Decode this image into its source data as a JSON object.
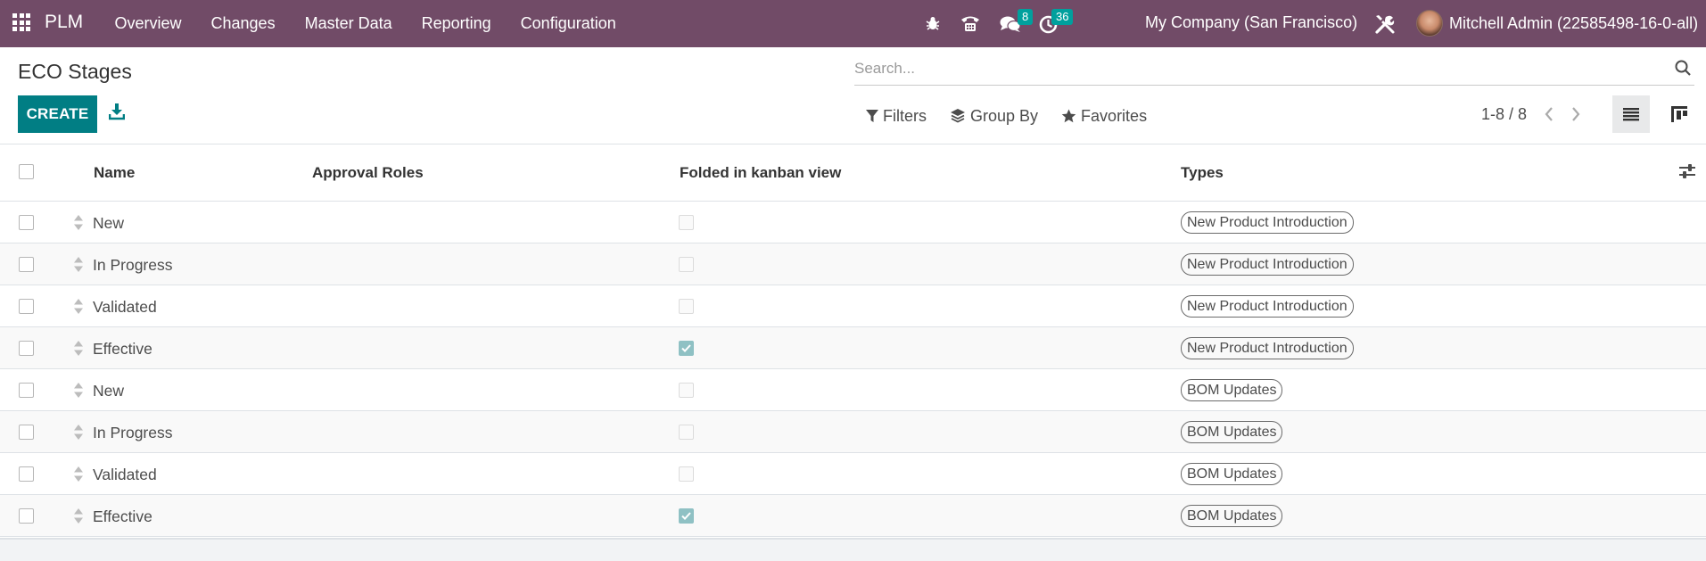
{
  "navbar": {
    "app_name": "PLM",
    "menu": [
      "Overview",
      "Changes",
      "Master Data",
      "Reporting",
      "Configuration"
    ],
    "messages_badge": "8",
    "activities_badge": "36",
    "company": "My Company (San Francisco)",
    "user": "Mitchell Admin (22585498-16-0-all)"
  },
  "control_panel": {
    "breadcrumb": "ECO Stages",
    "create_label": "CREATE",
    "search_placeholder": "Search...",
    "filters_label": "Filters",
    "group_by_label": "Group By",
    "favorites_label": "Favorites",
    "pager": "1-8 / 8"
  },
  "table": {
    "columns": [
      "Name",
      "Approval Roles",
      "Folded in kanban view",
      "Types"
    ],
    "rows": [
      {
        "name": "New",
        "approval_roles": "",
        "folded": false,
        "type": "New Product Introduction"
      },
      {
        "name": "In Progress",
        "approval_roles": "",
        "folded": false,
        "type": "New Product Introduction"
      },
      {
        "name": "Validated",
        "approval_roles": "",
        "folded": false,
        "type": "New Product Introduction"
      },
      {
        "name": "Effective",
        "approval_roles": "",
        "folded": true,
        "type": "New Product Introduction"
      },
      {
        "name": "New",
        "approval_roles": "",
        "folded": false,
        "type": "BOM Updates"
      },
      {
        "name": "In Progress",
        "approval_roles": "",
        "folded": false,
        "type": "BOM Updates"
      },
      {
        "name": "Validated",
        "approval_roles": "",
        "folded": false,
        "type": "BOM Updates"
      },
      {
        "name": "Effective",
        "approval_roles": "",
        "folded": true,
        "type": "BOM Updates"
      }
    ]
  },
  "colors": {
    "navbar": "#714b67",
    "primary": "#017e84",
    "badge": "#00a09d",
    "checked": "#8fc1c4"
  }
}
